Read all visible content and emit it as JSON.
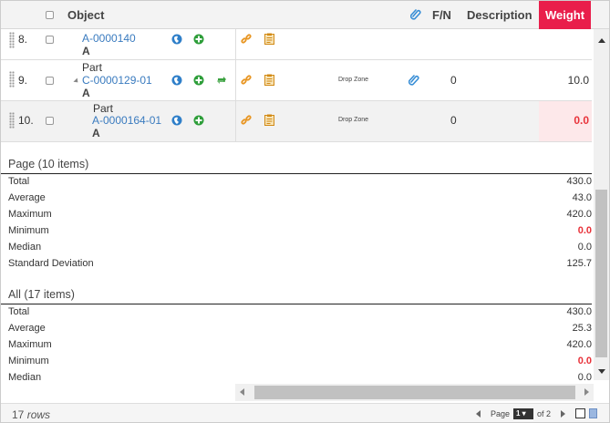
{
  "header": {
    "object": "Object",
    "fn": "F/N",
    "description": "Description",
    "weight": "Weight"
  },
  "rows": [
    {
      "num": "8.",
      "type": "",
      "id": "A-0000140",
      "rev": "A",
      "drop_zone": "",
      "fn": "",
      "weight": ""
    },
    {
      "num": "9.",
      "type": "Part",
      "id": "C-0000129-01",
      "rev": "A",
      "drop_zone": "Drop Zone",
      "fn": "0",
      "weight": "10.0"
    },
    {
      "num": "10.",
      "type": "Part",
      "id": "A-0000164-01",
      "rev": "A",
      "drop_zone": "Drop Zone",
      "fn": "0",
      "weight": "0.0"
    }
  ],
  "page_summary": {
    "title": "Page (10 items)",
    "items": [
      {
        "label": "Total",
        "value": "430.0"
      },
      {
        "label": "Average",
        "value": "43.0"
      },
      {
        "label": "Maximum",
        "value": "420.0"
      },
      {
        "label": "Minimum",
        "value": "0.0"
      },
      {
        "label": "Median",
        "value": "0.0"
      },
      {
        "label": "Standard Deviation",
        "value": "125.7"
      }
    ]
  },
  "all_summary": {
    "title": "All (17 items)",
    "items": [
      {
        "label": "Total",
        "value": "430.0"
      },
      {
        "label": "Average",
        "value": "25.3"
      },
      {
        "label": "Maximum",
        "value": "420.0"
      },
      {
        "label": "Minimum",
        "value": "0.0"
      },
      {
        "label": "Median",
        "value": "0.0"
      }
    ]
  },
  "footer": {
    "row_count": "17",
    "rows_word": "rows",
    "page_label": "Page",
    "page_value": "1",
    "page_of": "of 2"
  },
  "colors": {
    "accent": "#e91e4b",
    "link": "#3a7bbf",
    "negative": "#e8323a"
  }
}
